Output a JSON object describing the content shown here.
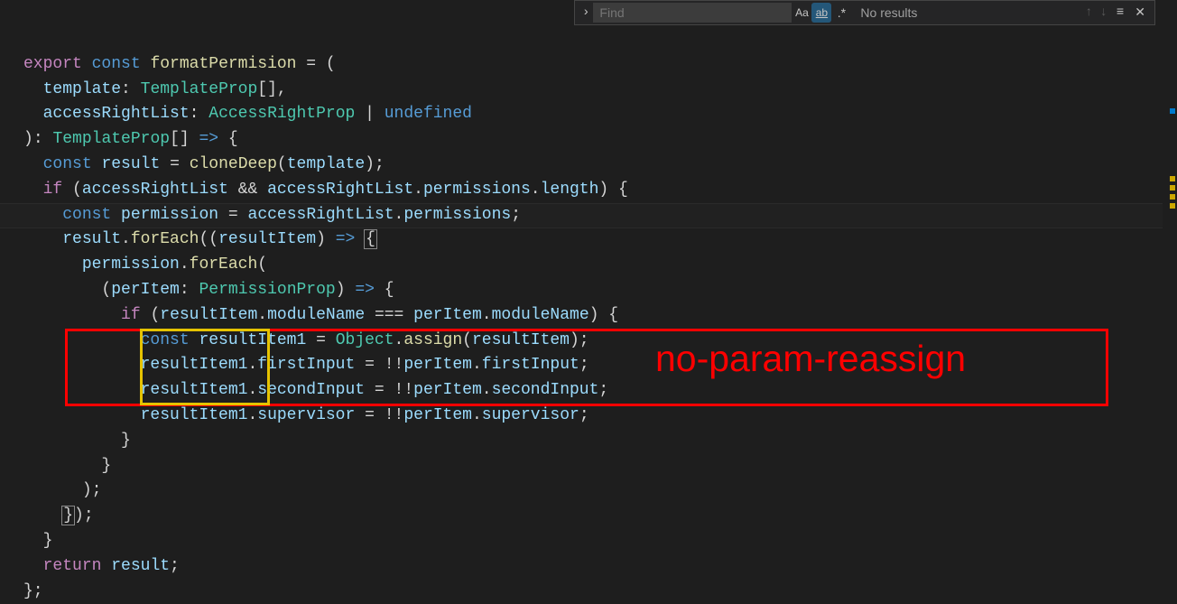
{
  "find": {
    "placeholder": "Find",
    "case_btn": "Aa",
    "word_btn": "ab",
    "regex_btn": ".*",
    "results": "No results"
  },
  "annotation": "no-param-reassign",
  "code": {
    "l1": {
      "export": "export",
      "const": "const",
      "name": "formatPermision",
      "eq": "=",
      "open": "("
    },
    "l2": {
      "param": "template",
      "colon": ":",
      "type": "TemplateProp",
      "arr": "[]",
      "comma": ","
    },
    "l3": {
      "param": "accessRightList",
      "colon": ":",
      "type": "AccessRightProp",
      "pipe": "|",
      "undef": "undefined"
    },
    "l4": {
      "close": ")",
      "colon": ":",
      "type": "TemplateProp",
      "arr": "[]",
      "arrow": "=>",
      "brace": "{"
    },
    "l5": {
      "const": "const",
      "name": "result",
      "eq": "=",
      "fn": "cloneDeep",
      "open": "(",
      "arg": "template",
      "close": ");"
    },
    "l6": {
      "if": "if",
      "open": "(",
      "a": "accessRightList",
      "and": "&&",
      "b": "accessRightList",
      "dot": ".",
      "p": "permissions",
      "dot2": ".",
      "len": "length",
      "close": ")",
      "brace": "{"
    },
    "l7": {
      "const": "const",
      "name": "permission",
      "eq": "=",
      "a": "accessRightList",
      "dot": ".",
      "p": "permissions",
      "semi": ";"
    },
    "l8": {
      "a": "result",
      "dot": ".",
      "fn": "forEach",
      "open": "((",
      "param": "resultItem",
      "close": ")",
      "arrow": "=>",
      "brace": "{"
    },
    "l9": {
      "a": "permission",
      "dot": ".",
      "fn": "forEach",
      "open": "("
    },
    "l10": {
      "open": "(",
      "param": "perItem",
      "colon": ":",
      "type": "PermissionProp",
      "close": ")",
      "arrow": "=>",
      "brace": "{"
    },
    "l11": {
      "if": "if",
      "open": "(",
      "a": "resultItem",
      "dot": ".",
      "p": "moduleName",
      "eq": "===",
      "b": "perItem",
      "dot2": ".",
      "p2": "moduleName",
      "close": ")",
      "brace": "{"
    },
    "l12": {
      "const": "const",
      "name": "resultItem1",
      "eq": "=",
      "obj": "Object",
      "dot": ".",
      "fn": "assign",
      "open": "(",
      "arg": "resultItem",
      "close": ");"
    },
    "l13": {
      "a": "resultItem1",
      "dot": ".",
      "p": "firstInput",
      "eq": "=",
      "bang": "!!",
      "b": "perItem",
      "dot2": ".",
      "p2": "firstInput",
      "semi": ";"
    },
    "l14": {
      "a": "resultItem1",
      "dot": ".",
      "p": "secondInput",
      "eq": "=",
      "bang": "!!",
      "b": "perItem",
      "dot2": ".",
      "p2": "secondInput",
      "semi": ";"
    },
    "l15": {
      "a": "resultItem1",
      "dot": ".",
      "p": "supervisor",
      "eq": "=",
      "bang": "!!",
      "b": "perItem",
      "dot2": ".",
      "p2": "supervisor",
      "semi": ";"
    },
    "l16": {
      "brace": "}"
    },
    "l17": {
      "brace": "}"
    },
    "l18": {
      "close": ");"
    },
    "l19": {
      "close": "});"
    },
    "l20": {
      "brace": "}"
    },
    "l21": {
      "return": "return",
      "name": "result",
      "semi": ";"
    },
    "l22": {
      "close": "};"
    }
  }
}
